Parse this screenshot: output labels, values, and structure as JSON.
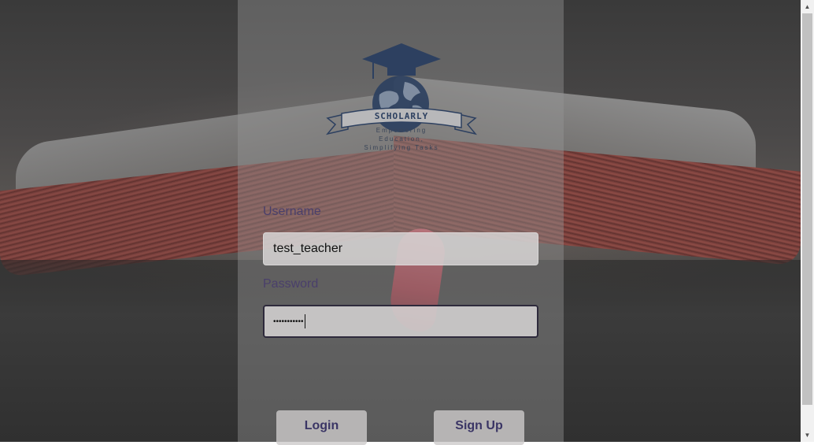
{
  "brand": {
    "name": "SCHOLARLY",
    "tagline_lines": [
      "Empowering",
      "Education,",
      "Simplifying Tasks"
    ]
  },
  "form": {
    "username_label": "Username",
    "username_value": "test_teacher",
    "password_label": "Password",
    "password_masked": "•••••••••••"
  },
  "buttons": {
    "login": "Login",
    "signup": "Sign Up"
  },
  "scrollbar": {
    "up_icon": "▲",
    "down_icon": "▼"
  },
  "colors": {
    "label": "#4a3f6b",
    "button_text": "#3a3565",
    "logo": "#2d4060"
  }
}
